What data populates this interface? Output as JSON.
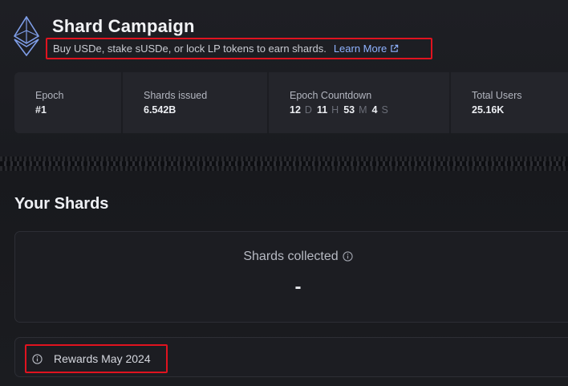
{
  "header": {
    "title": "Shard Campaign",
    "subtitle": "Buy USDe, stake sUSDe, or lock LP tokens to earn shards.",
    "learn_more": "Learn More"
  },
  "stats": {
    "epoch_label": "Epoch",
    "epoch_value": "#1",
    "shards_issued_label": "Shards issued",
    "shards_issued_value": "6.542B",
    "countdown_label": "Epoch Countdown",
    "countdown": {
      "days": "12",
      "days_unit": "D",
      "hours": "11",
      "hours_unit": "H",
      "minutes": "53",
      "minutes_unit": "M",
      "seconds": "4",
      "seconds_unit": "S"
    },
    "users_label": "Total Users",
    "users_value": "25.16K"
  },
  "shards": {
    "heading": "Your Shards",
    "collected_label": "Shards collected",
    "collected_value": "-"
  },
  "rewards": {
    "label": "Rewards May 2024"
  },
  "colors": {
    "accent_link": "#8fb2ff",
    "highlight": "#e0131f",
    "logo": "#7f9ee8"
  },
  "icons": {
    "logo": "ethereum-diamond-icon",
    "external": "external-link-icon",
    "info": "info-icon"
  }
}
